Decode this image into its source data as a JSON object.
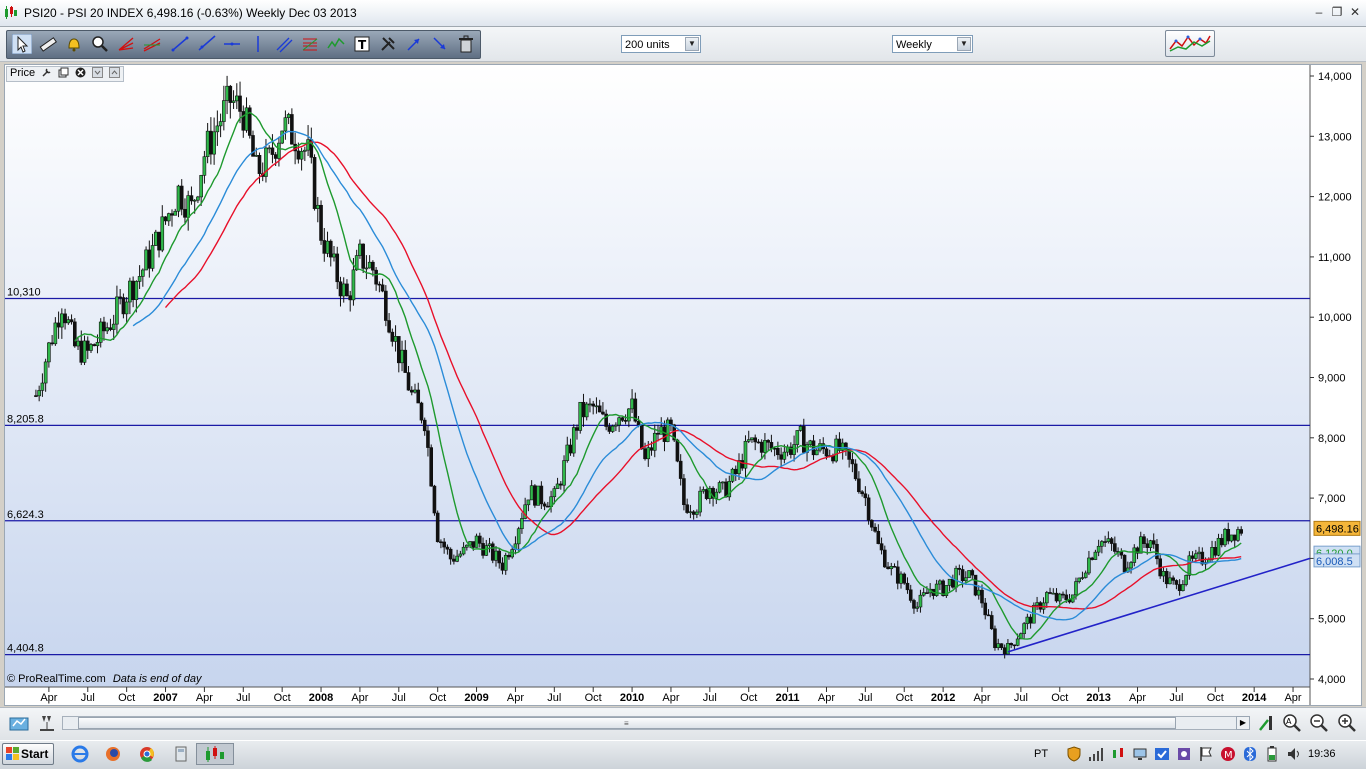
{
  "window": {
    "title": "PSI20 - PSI 20 INDEX   6,498.16 (-0.63%)   Weekly  Dec 03 2013"
  },
  "toolbar": {
    "units_select": "200 units",
    "timeframe_select": "Weekly",
    "tools": [
      "pointer-icon",
      "ruler-icon",
      "alert-bell-icon",
      "zoom-magnifier-icon",
      "fan-icon",
      "channel-icon",
      "trendline-icon",
      "ray-icon",
      "horizontal-line-icon",
      "vertical-line-icon",
      "parallel-lines-icon",
      "fibonacci-icon",
      "wave-icon",
      "text-tool-icon",
      "tools-icon",
      "arrow-up-icon",
      "arrow-down-icon",
      "trash-icon"
    ]
  },
  "chart_header": {
    "label": "Price"
  },
  "chart_footer": {
    "copyright": "© ProRealTime.com",
    "note": "Data is end of day"
  },
  "chart_data": {
    "type": "candlestick",
    "instrument": "PSI20",
    "interval": "Weekly",
    "y_axis": {
      "ticks": [
        "14,000",
        "13,000",
        "12,000",
        "11,000",
        "10,000",
        "9,000",
        "8,000",
        "7,000",
        "6,000",
        "5,000",
        "4,000"
      ],
      "ylim": [
        4000,
        14200
      ]
    },
    "x_axis": {
      "ticks": [
        "Apr",
        "Jul",
        "Oct",
        "2007",
        "Apr",
        "Jul",
        "Oct",
        "2008",
        "Apr",
        "Jul",
        "Oct",
        "2009",
        "Apr",
        "Jul",
        "Oct",
        "2010",
        "Apr",
        "Jul",
        "Oct",
        "2011",
        "Apr",
        "Jul",
        "Oct",
        "2012",
        "Apr",
        "Jul",
        "Oct",
        "2013",
        "Apr",
        "Jul",
        "Oct",
        "2014",
        "Apr"
      ],
      "bold": [
        "2007",
        "2008",
        "2009",
        "2010",
        "2011",
        "2012",
        "2013",
        "2014"
      ]
    },
    "horizontal_levels": [
      {
        "label": "10,310",
        "value": 10310
      },
      {
        "label": "8,205.8",
        "value": 8205.8
      },
      {
        "label": "6,624.3",
        "value": 6624.3
      },
      {
        "label": "4,404.8",
        "value": 4404.8
      }
    ],
    "last_price_label": "6,498.16",
    "ma_labels": [
      "6,120.0",
      "6,008.5"
    ],
    "trendline": {
      "from": [
        "2012-Jun",
        4450
      ],
      "to": [
        "2014-May",
        6000
      ]
    },
    "price_path": [
      [
        "2006-Mar",
        8700
      ],
      [
        "2006-Apr",
        9500
      ],
      [
        "2006-May",
        10250
      ],
      [
        "2006-Jun",
        9500
      ],
      [
        "2006-Jul",
        9400
      ],
      [
        "2006-Aug",
        9700
      ],
      [
        "2006-Sep",
        10000
      ],
      [
        "2006-Oct",
        10400
      ],
      [
        "2006-Nov",
        10700
      ],
      [
        "2006-Dec",
        11100
      ],
      [
        "2007-Jan",
        11600
      ],
      [
        "2007-Feb",
        12100
      ],
      [
        "2007-Mar",
        11800
      ],
      [
        "2007-Apr",
        12700
      ],
      [
        "2007-May",
        13200
      ],
      [
        "2007-Jun",
        13600
      ],
      [
        "2007-Jul",
        13400
      ],
      [
        "2007-Aug",
        12400
      ],
      [
        "2007-Sep",
        12600
      ],
      [
        "2007-Oct",
        13200
      ],
      [
        "2007-Nov",
        13000
      ],
      [
        "2007-Dec",
        12700
      ],
      [
        "2008-Jan",
        11400
      ],
      [
        "2008-Feb",
        10800
      ],
      [
        "2008-Mar",
        10300
      ],
      [
        "2008-Apr",
        11000
      ],
      [
        "2008-May",
        10800
      ],
      [
        "2008-Jun",
        10200
      ],
      [
        "2008-Jul",
        9400
      ],
      [
        "2008-Aug",
        8700
      ],
      [
        "2008-Sep",
        8300
      ],
      [
        "2008-Oct",
        6400
      ],
      [
        "2008-Nov",
        6000
      ],
      [
        "2008-Dec",
        6100
      ],
      [
        "2009-Jan",
        6300
      ],
      [
        "2009-Feb",
        6100
      ],
      [
        "2009-Mar",
        5900
      ],
      [
        "2009-Apr",
        6400
      ],
      [
        "2009-May",
        7100
      ],
      [
        "2009-Jun",
        7000
      ],
      [
        "2009-Jul",
        7000
      ],
      [
        "2009-Aug",
        7700
      ],
      [
        "2009-Sep",
        8400
      ],
      [
        "2009-Oct",
        8500
      ],
      [
        "2009-Nov",
        8200
      ],
      [
        "2009-Dec",
        8400
      ],
      [
        "2010-Jan",
        8500
      ],
      [
        "2010-Feb",
        7600
      ],
      [
        "2010-Mar",
        8100
      ],
      [
        "2010-Apr",
        8100
      ],
      [
        "2010-May",
        6900
      ],
      [
        "2010-Jun",
        6900
      ],
      [
        "2010-Jul",
        7200
      ],
      [
        "2010-Aug",
        7100
      ],
      [
        "2010-Sep",
        7400
      ],
      [
        "2010-Oct",
        7900
      ],
      [
        "2010-Nov",
        7900
      ],
      [
        "2010-Dec",
        7800
      ],
      [
        "2011-Jan",
        7800
      ],
      [
        "2011-Feb",
        8000
      ],
      [
        "2011-Mar",
        7800
      ],
      [
        "2011-Apr",
        7800
      ],
      [
        "2011-May",
        7800
      ],
      [
        "2011-Jun",
        7500
      ],
      [
        "2011-Jul",
        7000
      ],
      [
        "2011-Aug",
        6200
      ],
      [
        "2011-Sep",
        5800
      ],
      [
        "2011-Oct",
        5600
      ],
      [
        "2011-Nov",
        5200
      ],
      [
        "2011-Dec",
        5500
      ],
      [
        "2012-Jan",
        5500
      ],
      [
        "2012-Feb",
        5700
      ],
      [
        "2012-Mar",
        5700
      ],
      [
        "2012-Apr",
        5300
      ],
      [
        "2012-May",
        4600
      ],
      [
        "2012-Jun",
        4500
      ],
      [
        "2012-Jul",
        4800
      ],
      [
        "2012-Aug",
        5100
      ],
      [
        "2012-Sep",
        5400
      ],
      [
        "2012-Oct",
        5300
      ],
      [
        "2012-Nov",
        5400
      ],
      [
        "2012-Dec",
        5900
      ],
      [
        "2013-Jan",
        6300
      ],
      [
        "2013-Feb",
        6200
      ],
      [
        "2013-Mar",
        5900
      ],
      [
        "2013-Apr",
        6200
      ],
      [
        "2013-May",
        6300
      ],
      [
        "2013-Jun",
        5700
      ],
      [
        "2013-Jul",
        5500
      ],
      [
        "2013-Aug",
        5900
      ],
      [
        "2013-Sep",
        6000
      ],
      [
        "2013-Oct",
        6200
      ],
      [
        "2013-Nov",
        6400
      ],
      [
        "2013-Dec",
        6498
      ]
    ],
    "series": [
      {
        "color": "#e8102a"
      },
      {
        "color": "#1e9a2e"
      },
      {
        "color": "#2b8cd8"
      }
    ],
    "colors": {
      "level_line": "#1a1aa6",
      "trendline": "#2222c8",
      "price_label_bg": "#f5b63a",
      "ma_label_bg": "#cfe0f4"
    }
  },
  "taskbar": {
    "start_label": "Start",
    "language": "PT",
    "clock": "19:36"
  }
}
